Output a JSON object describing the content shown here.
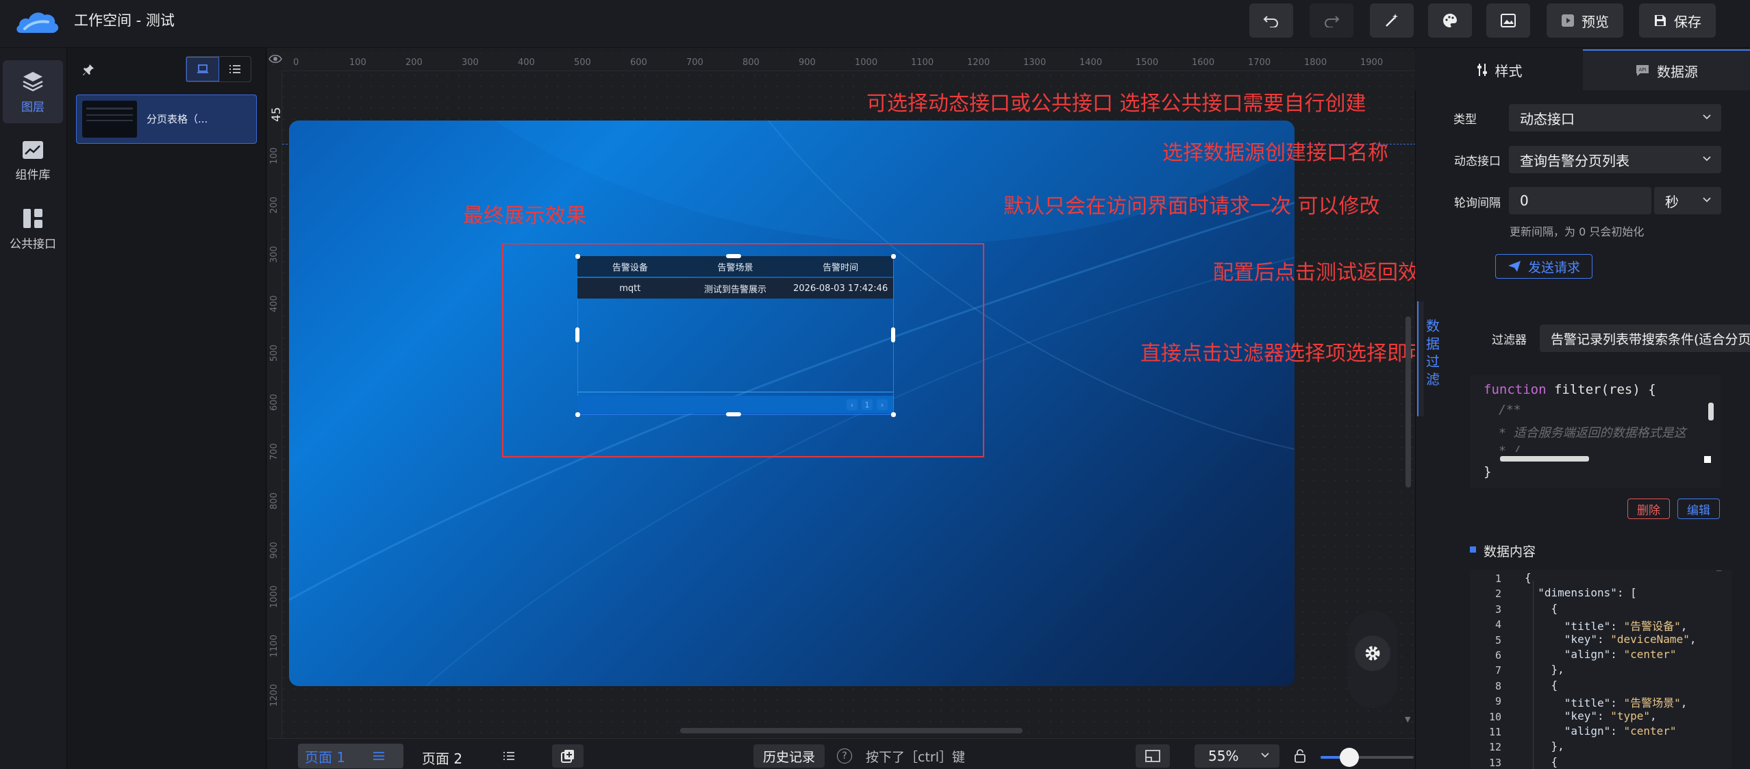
{
  "app": {
    "title": "工作空间 - 测试"
  },
  "toolbar": {
    "preview": "预览",
    "save": "保存"
  },
  "rail": [
    {
      "label": "图层",
      "icon": "layers-icon"
    },
    {
      "label": "组件库",
      "icon": "chart-library-icon"
    },
    {
      "label": "公共接口",
      "icon": "grid-api-icon"
    }
  ],
  "layers": {
    "item_label": "分页表格（..."
  },
  "ruler": {
    "h": [
      "0",
      "100",
      "200",
      "300",
      "400",
      "500",
      "600",
      "700",
      "800",
      "900",
      "1000",
      "1100",
      "1200",
      "1300",
      "1400",
      "1500",
      "1600",
      "1700",
      "1800",
      "1900"
    ],
    "v": [
      "100",
      "200",
      "300",
      "400",
      "500",
      "600",
      "700",
      "800",
      "900",
      "1000",
      "1100",
      "1200"
    ],
    "guide_value": "45"
  },
  "table": {
    "headers": [
      "告警设备",
      "告警场景",
      "告警时间"
    ],
    "row": [
      "mqtt",
      "测试到告警展示",
      "2026-08-03 17:42:46"
    ],
    "page": "1"
  },
  "annotations": {
    "final_effect": "最终展示效果",
    "type_hint": "可选择动态接口或公共接口  选择公共接口需要自行创建",
    "interface_hint": "选择数据源创建接口名称",
    "poll_hint": "默认只会在访问界面时请求一次 可以修改",
    "test_hint": "配置后点击测试返回效果",
    "filter_hint": "直接点击过滤器选择项选择即可"
  },
  "bottom": {
    "page1": "页面 1",
    "page2": "页面 2",
    "history": "历史记录",
    "ctrl_hint": "按下了［ctrl］键",
    "zoom": "55%"
  },
  "right": {
    "tab_style": "样式",
    "tab_datasource": "数据源",
    "type_label": "类型",
    "type_value": "动态接口",
    "interface_label": "动态接口",
    "interface_value": "查询告警分页列表",
    "poll_label": "轮询间隔",
    "poll_value": "0",
    "poll_unit": "秒",
    "poll_help": "更新间隔，为 0 只会初始化",
    "send_request": "发送请求",
    "side_tab": "数据过滤",
    "filter_label": "过滤器",
    "filter_value": "告警记录列表带搜索条件(适合分页)",
    "code": {
      "kw": "function",
      "sig": "filter(res) {",
      "c1": "/**",
      "c2": "* 适合服务端返回的数据格式是这",
      "c3": "* /",
      "end": "}"
    },
    "delete": "删除",
    "edit": "编辑",
    "data_content": "数据内容",
    "json_lines": [
      "{",
      "  \"dimensions\": [",
      "    {",
      "      \"title\": \"告警设备\",",
      "      \"key\": \"deviceName\",",
      "      \"align\": \"center\"",
      "    },",
      "    {",
      "      \"title\": \"告警场景\",",
      "      \"key\": \"type\",",
      "      \"align\": \"center\"",
      "    },",
      "    {"
    ]
  }
}
